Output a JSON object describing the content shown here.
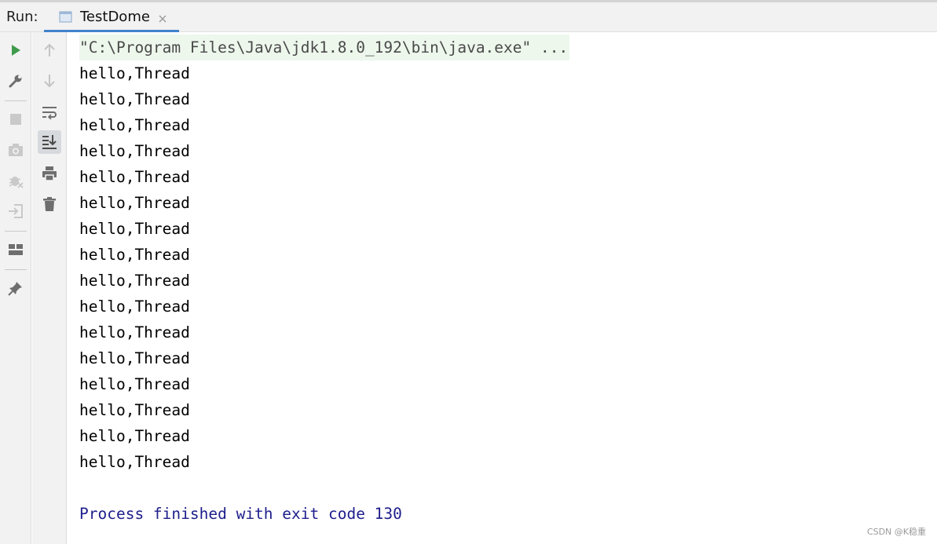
{
  "header": {
    "run_label": "Run:",
    "tab_title": "TestDome"
  },
  "toolbar_left": [
    {
      "name": "rerun-icon",
      "color": "#3e9b4b"
    },
    {
      "name": "wrench-icon"
    },
    {
      "name": "stop-icon"
    },
    {
      "name": "camera-icon"
    },
    {
      "name": "debug-icon"
    },
    {
      "name": "exit-icon"
    },
    {
      "name": "layout-icon"
    },
    {
      "name": "pin-icon"
    }
  ],
  "toolbar_mid": [
    {
      "name": "up-arrow-icon"
    },
    {
      "name": "down-arrow-icon"
    },
    {
      "name": "soft-wrap-icon"
    },
    {
      "name": "scroll-to-end-icon",
      "selected": true
    },
    {
      "name": "print-icon"
    },
    {
      "name": "trash-icon"
    }
  ],
  "console": {
    "command_line": "\"C:\\Program Files\\Java\\jdk1.8.0_192\\bin\\java.exe\" ...",
    "output_lines": [
      "hello,Thread",
      "hello,Thread",
      "hello,Thread",
      "hello,Thread",
      "hello,Thread",
      "hello,Thread",
      "hello,Thread",
      "hello,Thread",
      "hello,Thread",
      "hello,Thread",
      "hello,Thread",
      "hello,Thread",
      "hello,Thread",
      "hello,Thread",
      "hello,Thread",
      "hello,Thread"
    ],
    "exit_message": "Process finished with exit code 130"
  },
  "watermark": "CSDN @K稳重",
  "colors": {
    "accent": "#4083c9",
    "run_green": "#3e9b4b",
    "command_bg": "#edf7ec",
    "exit_text": "#1d1d8c"
  }
}
